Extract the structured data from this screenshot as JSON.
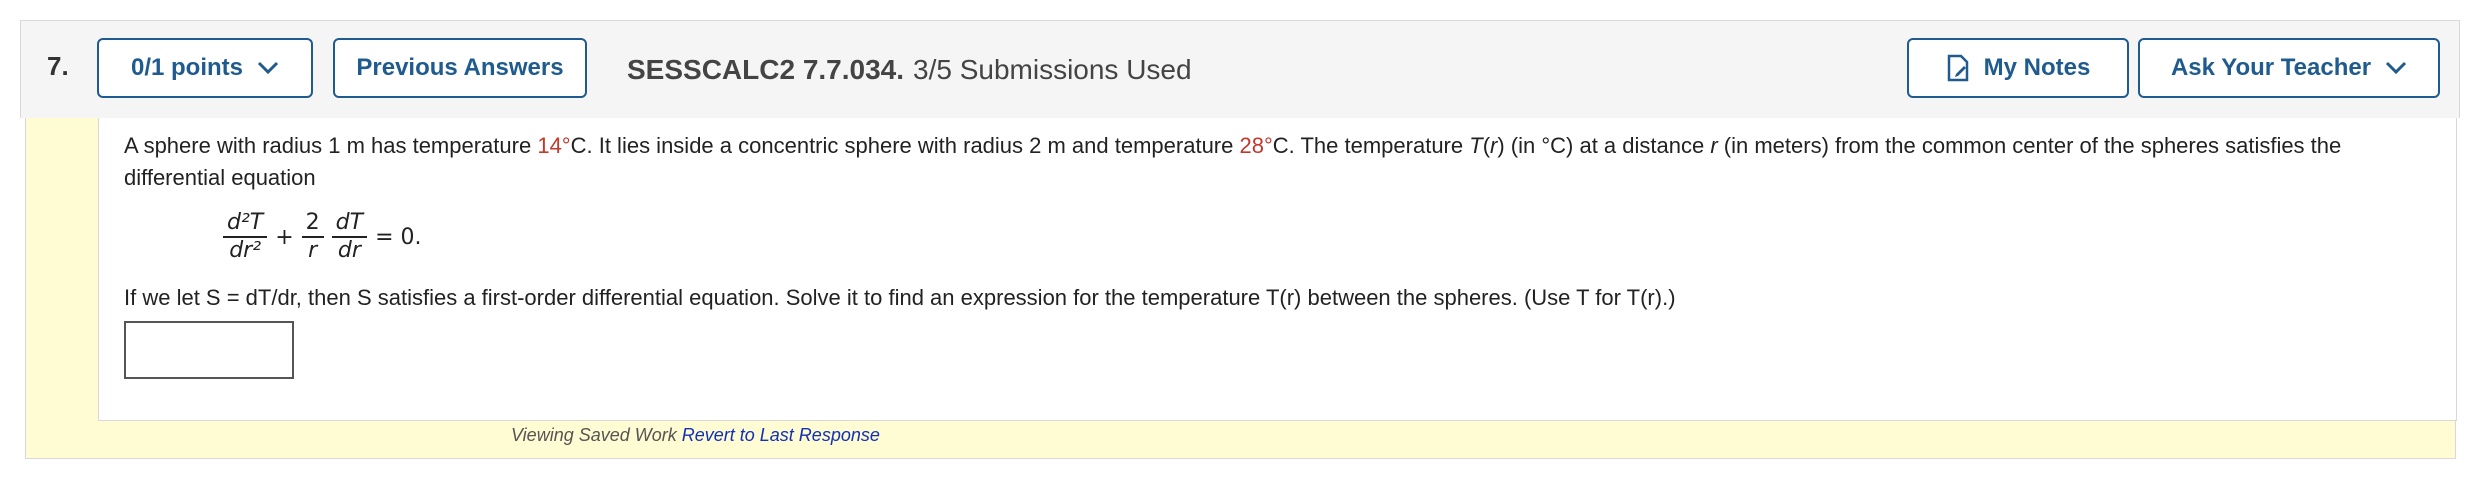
{
  "header": {
    "question_number": "7.",
    "points_label": "0/1 points",
    "previous_answers_label": "Previous Answers",
    "question_id": "SESSCALC2 7.7.034.",
    "submissions": "3/5 Submissions Used",
    "my_notes_label": "My Notes",
    "ask_teacher_label": "Ask Your Teacher"
  },
  "question": {
    "p1_a": "A sphere with radius 1 m has temperature ",
    "temp1": "14°",
    "p1_b": "C. It lies inside a concentric sphere with radius 2 m and temperature ",
    "temp2": "28°",
    "p1_c": "C. The temperature ",
    "p1_T": "T",
    "p1_d": "(",
    "p1_r": "r",
    "p1_e": ") (in °C) at a distance ",
    "p1_r2": "r",
    "p1_f": " (in meters) from the common center of the spheres satisfies the differential equation",
    "eq_num1": "d²T",
    "eq_den1": "dr²",
    "eq_plus": "+",
    "eq_num2": "2",
    "eq_den2": "r",
    "eq_num3": "dT",
    "eq_den3": "dr",
    "eq_rhs": "= 0.",
    "p2": "If we let S = dT/dr, then S satisfies a first-order differential equation. Solve it to find an expression for the temperature T(r) between the spheres. (Use T for T(r).)",
    "answer_value": ""
  },
  "footer": {
    "viewing_text": "Viewing Saved Work ",
    "revert_link": "Revert to Last Response"
  },
  "colors": {
    "accent": "#1f5b8e",
    "highlight_red": "#c0392b",
    "panel_yellow": "#fffbd2"
  },
  "icons": {
    "points_chevron": "chevron-down-icon",
    "notes": "notes-icon",
    "teacher_chevron": "chevron-down-icon"
  }
}
